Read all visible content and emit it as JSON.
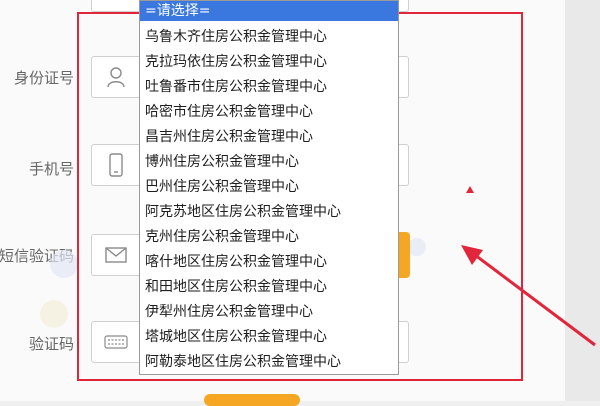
{
  "form": {
    "labels": {
      "id_number": "身份证号",
      "phone": "手机号",
      "sms_code": "短信验证码",
      "captcha": "验证码"
    }
  },
  "dropdown": {
    "selected": "=请选择=",
    "options": [
      "乌鲁木齐住房公积金管理中心",
      "克拉玛依住房公积金管理中心",
      "吐鲁番市住房公积金管理中心",
      "哈密市住房公积金管理中心",
      "昌吉州住房公积金管理中心",
      "博州住房公积金管理中心",
      "巴州住房公积金管理中心",
      "阿克苏地区住房公积金管理中心",
      "克州住房公积金管理中心",
      "喀什地区住房公积金管理中心",
      "和田地区住房公积金管理中心",
      "伊犁州住房公积金管理中心",
      "塔城地区住房公积金管理中心",
      "阿勒泰地区住房公积金管理中心"
    ]
  },
  "colors": {
    "highlight": "#e1253a",
    "selected_bg": "#3a78e0",
    "accent": "#f5a623"
  },
  "icons": [
    "user-icon",
    "phone-icon",
    "envelope-icon",
    "keyboard-icon",
    "arrow-annotation"
  ]
}
